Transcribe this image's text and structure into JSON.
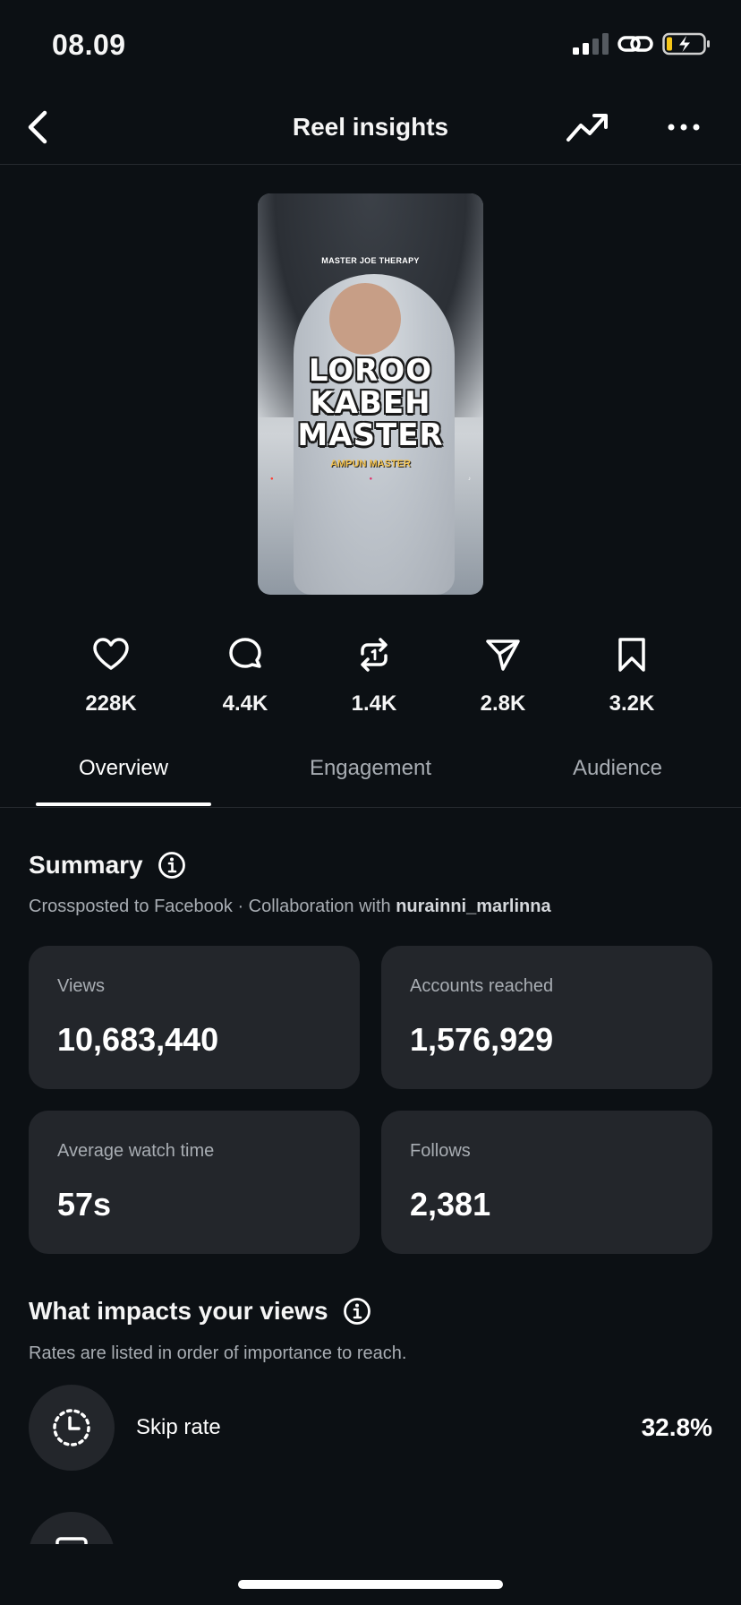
{
  "status_bar": {
    "time": "08.09"
  },
  "nav": {
    "title": "Reel insights"
  },
  "thumbnail": {
    "brand": "MASTER JOE THERAPY",
    "title": "LOROO\nKABEH\nMASTER",
    "subtitle": "AMPUN MASTER"
  },
  "stats": [
    {
      "icon": "heart-icon",
      "value": "228K"
    },
    {
      "icon": "comment-icon",
      "value": "4.4K"
    },
    {
      "icon": "repost-icon",
      "value": "1.4K"
    },
    {
      "icon": "share-icon",
      "value": "2.8K"
    },
    {
      "icon": "bookmark-icon",
      "value": "3.2K"
    }
  ],
  "tabs": [
    {
      "label": "Overview",
      "active": true
    },
    {
      "label": "Engagement",
      "active": false
    },
    {
      "label": "Audience",
      "active": false
    }
  ],
  "summary": {
    "title": "Summary",
    "subtitle_prefix": "Crossposted to Facebook · Collaboration with ",
    "collaborator": "nurainni_marlinna",
    "cards": [
      {
        "label": "Views",
        "value": "10,683,440"
      },
      {
        "label": "Accounts reached",
        "value": "1,576,929"
      },
      {
        "label": "Average watch time",
        "value": "57s"
      },
      {
        "label": "Follows",
        "value": "2,381"
      }
    ]
  },
  "impacts": {
    "title": "What impacts your views",
    "subtitle": "Rates are listed in order of importance to reach.",
    "items": [
      {
        "label": "Skip rate",
        "value": "32.8%"
      }
    ]
  },
  "colors": {
    "background": "#0c1014",
    "card": "#23262b",
    "muted_text": "#a8adb3",
    "battery_yellow": "#f5c518"
  }
}
